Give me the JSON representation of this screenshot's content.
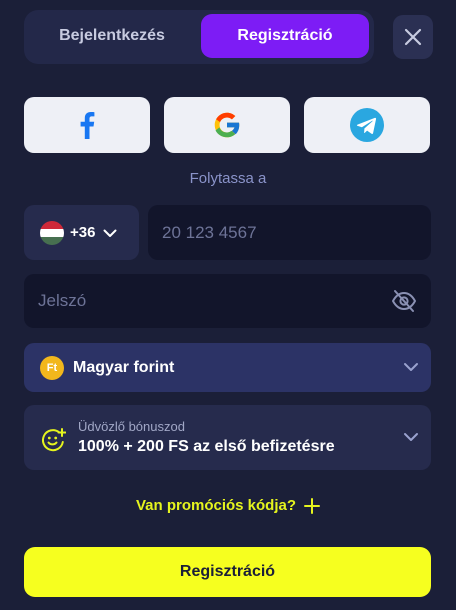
{
  "tabs": {
    "login_label": "Bejelentkezés",
    "register_label": "Regisztráció"
  },
  "icons": {
    "close": "close-icon",
    "facebook": "facebook-icon",
    "google": "google-icon",
    "telegram": "telegram-icon",
    "flag": "hungary-flag-icon",
    "eye": "eye-off-icon",
    "currency": "forint-icon",
    "bonus": "smiley-plus-icon",
    "chevron": "chevron-down-icon",
    "plus": "plus-icon"
  },
  "social": {
    "continue_text": "Folytassa a"
  },
  "phone": {
    "country_code": "+36",
    "placeholder": "20 123 4567"
  },
  "password": {
    "placeholder": "Jelszó"
  },
  "currency": {
    "badge": "Ft",
    "label": "Magyar forint"
  },
  "bonus": {
    "caption": "Üdvözlő bónuszod",
    "value": "100% + 200 FS az első befizetésre"
  },
  "promo": {
    "label": "Van promóciós kódja?"
  },
  "submit": {
    "label": "Regisztráció"
  },
  "colors": {
    "background": "#1b1f38",
    "tab_active": "#7d1cf5",
    "accent_yellow": "#f6ff1f",
    "promo_text": "#e5f41e",
    "coin": "#f2b71c"
  }
}
